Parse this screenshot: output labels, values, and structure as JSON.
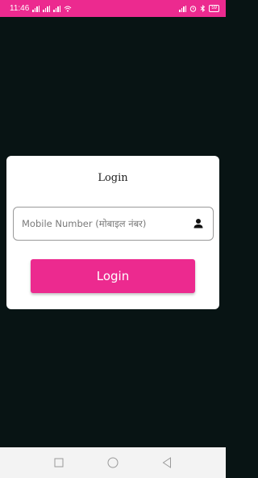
{
  "status_bar": {
    "time": "11:46",
    "battery": "59",
    "accent_color": "#ec2a8f"
  },
  "login_card": {
    "title": "Login",
    "mobile_placeholder": "Mobile Number (मोबाइल नंबर)",
    "mobile_value": "",
    "field_icon": "person-icon",
    "login_label": "Login"
  },
  "nav_bar": {
    "items": [
      "recents-square-icon",
      "home-circle-icon",
      "back-triangle-icon"
    ]
  }
}
